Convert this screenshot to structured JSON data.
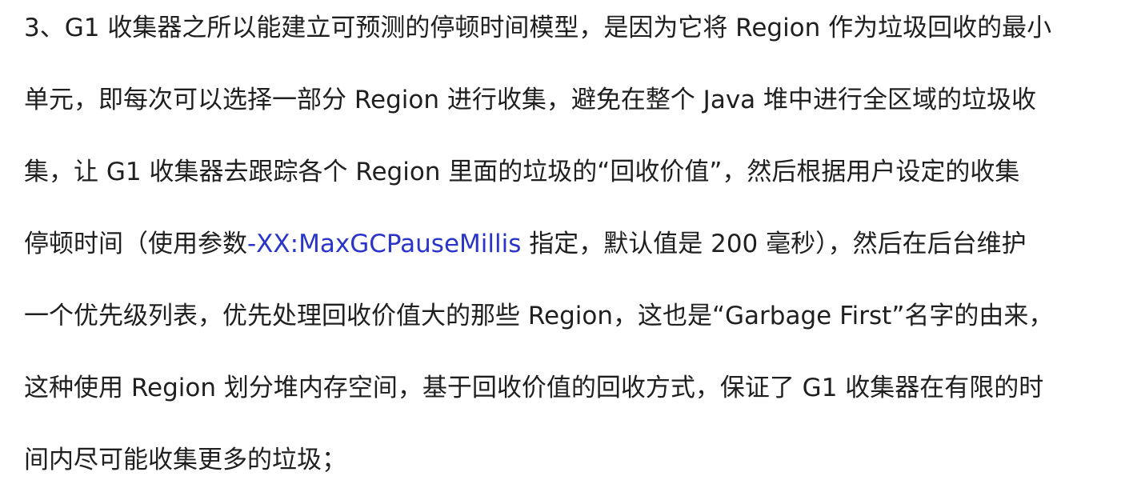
{
  "paragraph": {
    "lines": [
      "3、G1 收集器之所以能建立可预测的停顿时间模型，是因为它将 Region 作为垃圾回收的最小",
      "单元，即每次可以选择一部分 Region 进行收集，避免在整个 Java 堆中进行全区域的垃圾收",
      "集，让 G1 收集器去跟踪各个 Region 里面的垃圾的“回收价值”，然后根据用户设定的收集",
      {
        "before": "停顿时间（使用参数",
        "param": "-XX:MaxGCPauseMillis",
        "after": " 指定，默认值是 200 毫秒），然后在后台维护"
      },
      "一个优先级列表，优先处理回收价值大的那些 Region，这也是“Garbage First”名字的由来，",
      "这种使用 Region 划分堆内存空间，基于回收价值的回收方式，保证了 G1 收集器在有限的时",
      "间内尽可能收集更多的垃圾；"
    ]
  },
  "colors": {
    "text": "#1f1f1f",
    "parameter": "#2a34c9",
    "background": "#ffffff"
  }
}
